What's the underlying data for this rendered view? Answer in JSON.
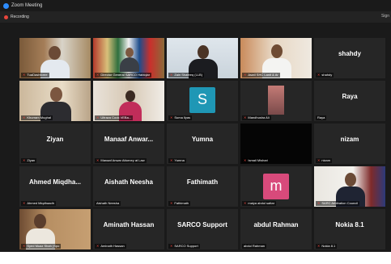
{
  "window": {
    "title": "Zoom Meeting"
  },
  "recording": {
    "label": "Recording"
  },
  "header": {
    "sign_label": "Sign"
  },
  "tiles": [
    {
      "name": "",
      "label": "TuaDashforee"
    },
    {
      "name": "",
      "label": "Director General SARCO Habiqlar"
    },
    {
      "name": "",
      "label": "Zain Shafeeq (LLB)"
    },
    {
      "name": "",
      "label": "Aswil SHC Lanit & Ar"
    },
    {
      "name": "shahdy",
      "label": "shahdy"
    },
    {
      "name": "",
      "label": "Khurram Mughal"
    },
    {
      "name": "",
      "label": "Ultraza Cook VEBa..."
    },
    {
      "name": "S",
      "label": "Suma Ilyas"
    },
    {
      "name": "",
      "label": "Mandhusha Ali"
    },
    {
      "name": "Raya",
      "label": "Raya"
    },
    {
      "name": "Ziyan",
      "label": "Ziyan"
    },
    {
      "name": "Manaaf Anwar...",
      "label": "Manaaf Anwar Attorney at Law"
    },
    {
      "name": "Yumna",
      "label": "Yumna"
    },
    {
      "name": "",
      "label": "Ismail Mishari"
    },
    {
      "name": "nizam",
      "label": "nizam"
    },
    {
      "name": "Ahmed Miqdha...",
      "label": "Ahmed Miqdhaadh"
    },
    {
      "name": "Aishath Neesha",
      "label": "Aishath Neesha"
    },
    {
      "name": "Fathimath",
      "label": "Fathimath"
    },
    {
      "name": "m",
      "label": "malya abdul sattar"
    },
    {
      "name": "",
      "label": "SARC Arbitration Council"
    },
    {
      "name": "",
      "label": "Syed Muaz Shah (Spo"
    },
    {
      "name": "Aminath Hassan",
      "label": "Aminath Hassan"
    },
    {
      "name": "SARCO Support",
      "label": "SARCO Support"
    },
    {
      "name": "abdul Rahman",
      "label": "abdul Rahman"
    },
    {
      "name": "Nokia 8.1",
      "label": "Nokia 8.1"
    }
  ],
  "colors": {
    "s_avatar": "#1f97b5",
    "m_avatar": "#d84a7b",
    "active_border": "#9ad037"
  }
}
